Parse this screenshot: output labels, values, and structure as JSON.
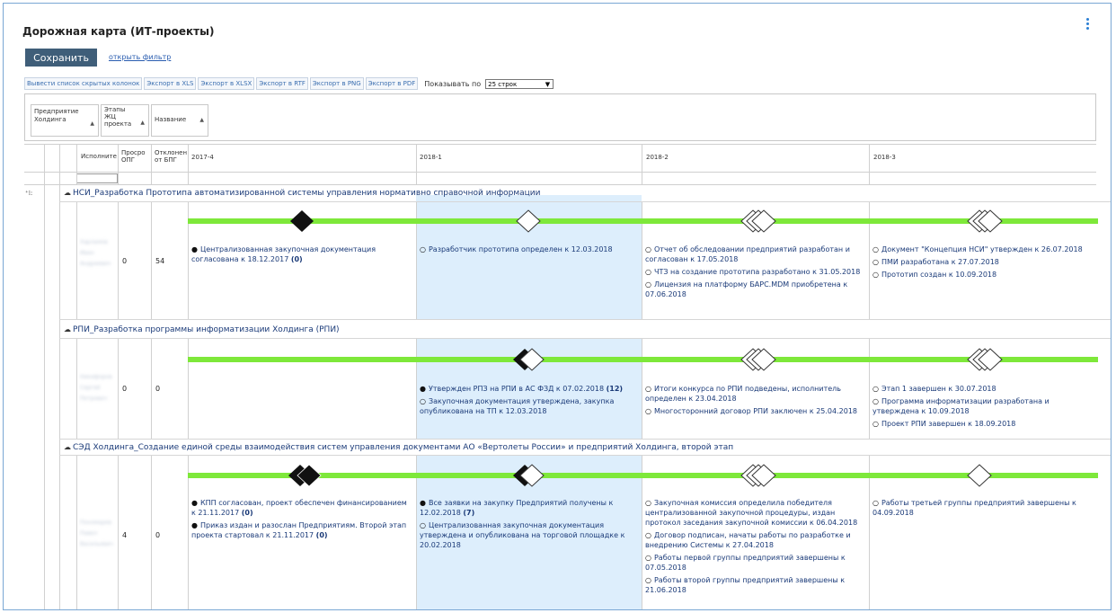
{
  "page": {
    "title": "Дорожная карта (ИТ-проекты)",
    "save_label": "Сохранить",
    "filter_link": "открыть фильтр"
  },
  "toolbar": {
    "buttons": [
      "Вывести список скрытых колонок",
      "Экспорт в XLS",
      "Экспорт в XLSX",
      "Экспорт в RTF",
      "Экспорт в PNG",
      "Экспорт в PDF"
    ],
    "show_label": "Показывать по",
    "rows_select": "25 строк"
  },
  "grouping": {
    "chips": [
      {
        "line1": "Предприятие",
        "line2": "Холдинга",
        "line3": "",
        "line4": ""
      },
      {
        "line1": "Этапы",
        "line2": "ЖЦ",
        "line3": "проекта",
        "line4": ""
      },
      {
        "line1": "Название",
        "line2": "",
        "line3": "",
        "line4": ""
      }
    ]
  },
  "columns": {
    "executor": "Исполните",
    "overdue1": "Просро",
    "overdue2": "ОПГ",
    "deviation1": "Отклонен",
    "deviation2": "от БПГ",
    "q1": "2017-4",
    "q2": "2018-1",
    "q3": "2018-2",
    "q4": "2018-3"
  },
  "projects": [
    {
      "title": "НСИ_Разработка Прототипа автоматизированной системы управления нормативно справочной информации",
      "executor": "Харламов Иван Андреевич",
      "overdue": "0",
      "deviation": "54",
      "q1": [
        {
          "text": "Централизованная закупочная документация согласована к 18.12.2017",
          "count": "(0)",
          "filled": true
        }
      ],
      "q2": [
        {
          "text": "Разработчик прототипа определен к 12.03.2018",
          "count": "",
          "filled": false
        }
      ],
      "q3": [
        {
          "text": "Отчет об обследовании предприятий разработан и согласован к 17.05.2018",
          "count": "",
          "filled": false
        },
        {
          "text": "ЧТЗ на создание прототипа разработано к 31.05.2018",
          "count": "",
          "filled": false
        },
        {
          "text": "Лицензия на платформу БАРС.MDM приобретена к 07.06.2018",
          "count": "",
          "filled": false
        }
      ],
      "q4": [
        {
          "text": "Документ \"Концепция НСИ\" утвержден к 26.07.2018",
          "count": "",
          "filled": false
        },
        {
          "text": "ПМИ разработана к 27.07.2018",
          "count": "",
          "filled": false
        },
        {
          "text": "Прототип создан к 10.09.2018",
          "count": "",
          "filled": false
        }
      ]
    },
    {
      "title": "РПИ_Разработка программы информатизации Холдинга (РПИ)",
      "executor": "Никифоров Сергей Петрович",
      "overdue": "0",
      "deviation": "0",
      "q1": [],
      "q2": [
        {
          "text": "Утвержден РПЗ на РПИ в АС ФЗД к 07.02.2018",
          "count": "(12)",
          "filled": true
        },
        {
          "text": "Закупочная документация утверждена, закупка опубликована на ТП к 12.03.2018",
          "count": "",
          "filled": false
        }
      ],
      "q3": [
        {
          "text": "Итоги конкурса по РПИ подведены, исполнитель определен к 23.04.2018",
          "count": "",
          "filled": false
        },
        {
          "text": "Многосторонний договор РПИ заключен к 25.04.2018",
          "count": "",
          "filled": false
        }
      ],
      "q4": [
        {
          "text": "Этап 1 завершен к 30.07.2018",
          "count": "",
          "filled": false
        },
        {
          "text": "Программа информатизации разработана и утверждена к 10.09.2018",
          "count": "",
          "filled": false
        },
        {
          "text": "Проект РПИ завершен к 18.09.2018",
          "count": "",
          "filled": false
        }
      ]
    },
    {
      "title": "СЭД Холдинга_Создание единой среды взаимодействия систем управления документами АО «Вертолеты России» и предприятий Холдинга, второй этап",
      "executor": "Пономарев Павел Васильевич",
      "overdue": "4",
      "deviation": "0",
      "q1": [
        {
          "text": "КПП согласован, проект обеспечен финансированием к 21.11.2017",
          "count": "(0)",
          "filled": true
        },
        {
          "text": "Приказ издан и разослан Предприятиям. Второй этап проекта стартовал к 21.11.2017",
          "count": "(0)",
          "filled": true
        }
      ],
      "q2": [
        {
          "text": "Все заявки на закупку Предприятий получены к 12.02.2018",
          "count": "(7)",
          "filled": true
        },
        {
          "text": "Централизованная закупочная документация утверждена и опубликована на торговой площадке к 20.02.2018",
          "count": "",
          "filled": false
        }
      ],
      "q3": [
        {
          "text": "Закупочная комиссия определила победителя централизованной закупочной процедуры, издан протокол заседания закупочной комиссии к 06.04.2018",
          "count": "",
          "filled": false
        },
        {
          "text": "Договор подписан, начаты работы по разработке и внедрению Системы к 27.04.2018",
          "count": "",
          "filled": false
        },
        {
          "text": "Работы первой группы предприятий завершены к 07.05.2018",
          "count": "",
          "filled": false
        },
        {
          "text": "Работы второй группы предприятий завершены к 21.06.2018",
          "count": "",
          "filled": false
        }
      ],
      "q4": [
        {
          "text": "Работы третьей группы предприятий завершены к 04.09.2018",
          "count": "",
          "filled": false
        }
      ]
    }
  ],
  "colors": {
    "accent": "#3f5e79",
    "link": "#2a5db0",
    "timeline": "#7ee83a",
    "current_quarter": "#ddeefc",
    "milestone_done": "#111111"
  }
}
